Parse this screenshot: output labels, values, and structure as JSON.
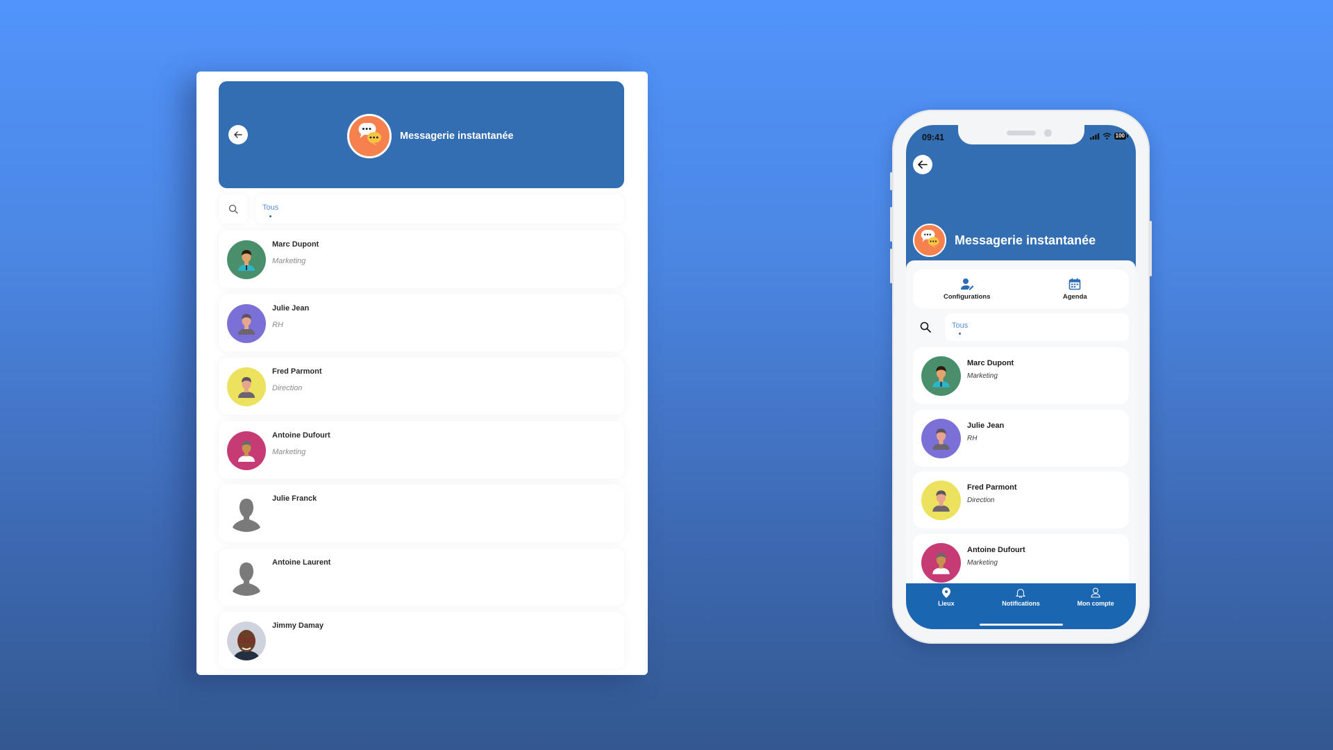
{
  "app": {
    "title": "Messagerie instantanée",
    "back_icon": "arrow-left-icon",
    "title_icon": "chat-bubbles-icon"
  },
  "colors": {
    "header_blue": "#336db2",
    "nav_blue": "#1b66b1",
    "chat_badge_orange": "#f6814f",
    "chat_bubble_yellow": "#f7c444",
    "filter_text": "#5b8ed0"
  },
  "search": {
    "icon": "search-icon",
    "filter_label": "Tous"
  },
  "contacts": [
    {
      "name": "Marc Dupont",
      "department": "Marketing",
      "avatar_color": "#4a8f6c",
      "avatar_type": "illustration-man-tie"
    },
    {
      "name": "Julie Jean",
      "department": "RH",
      "avatar_color": "#7a70d6",
      "avatar_type": "illustration-woman"
    },
    {
      "name": "Fred Parmont",
      "department": "Direction",
      "avatar_color": "#ece25e",
      "avatar_type": "illustration-man-jacket"
    },
    {
      "name": "Antoine Dufourt",
      "department": "Marketing",
      "avatar_color": "#c63b74",
      "avatar_type": "illustration-man-white"
    },
    {
      "name": "Julie Franck",
      "department": "",
      "avatar_color": "#ffffff",
      "avatar_type": "silhouette"
    },
    {
      "name": "Antoine Laurent",
      "department": "",
      "avatar_color": "#ffffff",
      "avatar_type": "silhouette"
    },
    {
      "name": "Jimmy Damay",
      "department": "",
      "avatar_color": "#cfd3de",
      "avatar_type": "photo"
    }
  ],
  "phone": {
    "status": {
      "time": "09:41",
      "battery": "100",
      "signal_icon": "signal-bars-icon",
      "wifi_icon": "wifi-icon"
    },
    "actions": [
      {
        "label": "Configurations",
        "icon": "user-edit-icon"
      },
      {
        "label": "Agenda",
        "icon": "calendar-icon"
      }
    ],
    "bottom_nav": [
      {
        "label": "Lieux",
        "icon": "map-pin-icon"
      },
      {
        "label": "Notifications",
        "icon": "bell-icon"
      },
      {
        "label": "Mon compte",
        "icon": "user-icon"
      }
    ]
  }
}
